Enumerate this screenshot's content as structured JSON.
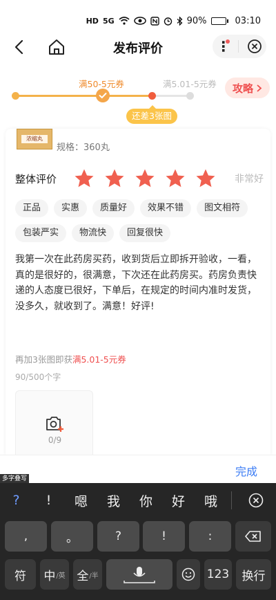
{
  "status_bar": {
    "network": "HD",
    "signal": "5G",
    "battery_percent": "90%",
    "battery_level": 0.9,
    "time": "03:10"
  },
  "nav": {
    "title": "发布评价",
    "icons": [
      "back-arrow-icon",
      "home-icon",
      "more-icon",
      "close-circle-icon"
    ]
  },
  "progress": {
    "milestone_1": "满50-5元券",
    "milestone_2": "满5.01-5元券",
    "strategy_label": "攻略",
    "gap_tip": "还差3张图",
    "accent_color": "#ef8a2b"
  },
  "product": {
    "spec": "规格：360丸",
    "thumb_text": "浓缩丸"
  },
  "rating": {
    "label": "整体评价",
    "stars": 5,
    "max_stars": 5,
    "text": "非常好",
    "star_color": "#f06050"
  },
  "tags": [
    "正品",
    "实惠",
    "质量好",
    "效果不错",
    "图文相符",
    "包装严实",
    "物流快",
    "回复很快"
  ],
  "review": {
    "text": "我第一次在此药房买药，收到货后立即拆开验收，一看，真的是很好的，很满意，下次还在此药房买。药房负责快递的人态度已很好，下单后，在规定的时间内准时发货，没多久，就收到了。满意！好评!",
    "bonus_prefix": "再加3张图即获",
    "bonus_highlight": "满5.01-5元券",
    "char_count": "90/500个字",
    "upload_count": "0/9"
  },
  "done_bar": {
    "done_label": "完成",
    "ime_label": "多字叠写"
  },
  "keyboard": {
    "candidates": [
      "?",
      "!",
      "嗯",
      "我",
      "你",
      "好",
      "哦"
    ],
    "row1": [
      ",",
      "。",
      "?",
      "!",
      ":"
    ],
    "row2": {
      "symbol": "符",
      "zh": "中",
      "zh_sub": "/英",
      "full": "全",
      "full_sub": "/半",
      "num": "123",
      "enter": "换行"
    }
  }
}
